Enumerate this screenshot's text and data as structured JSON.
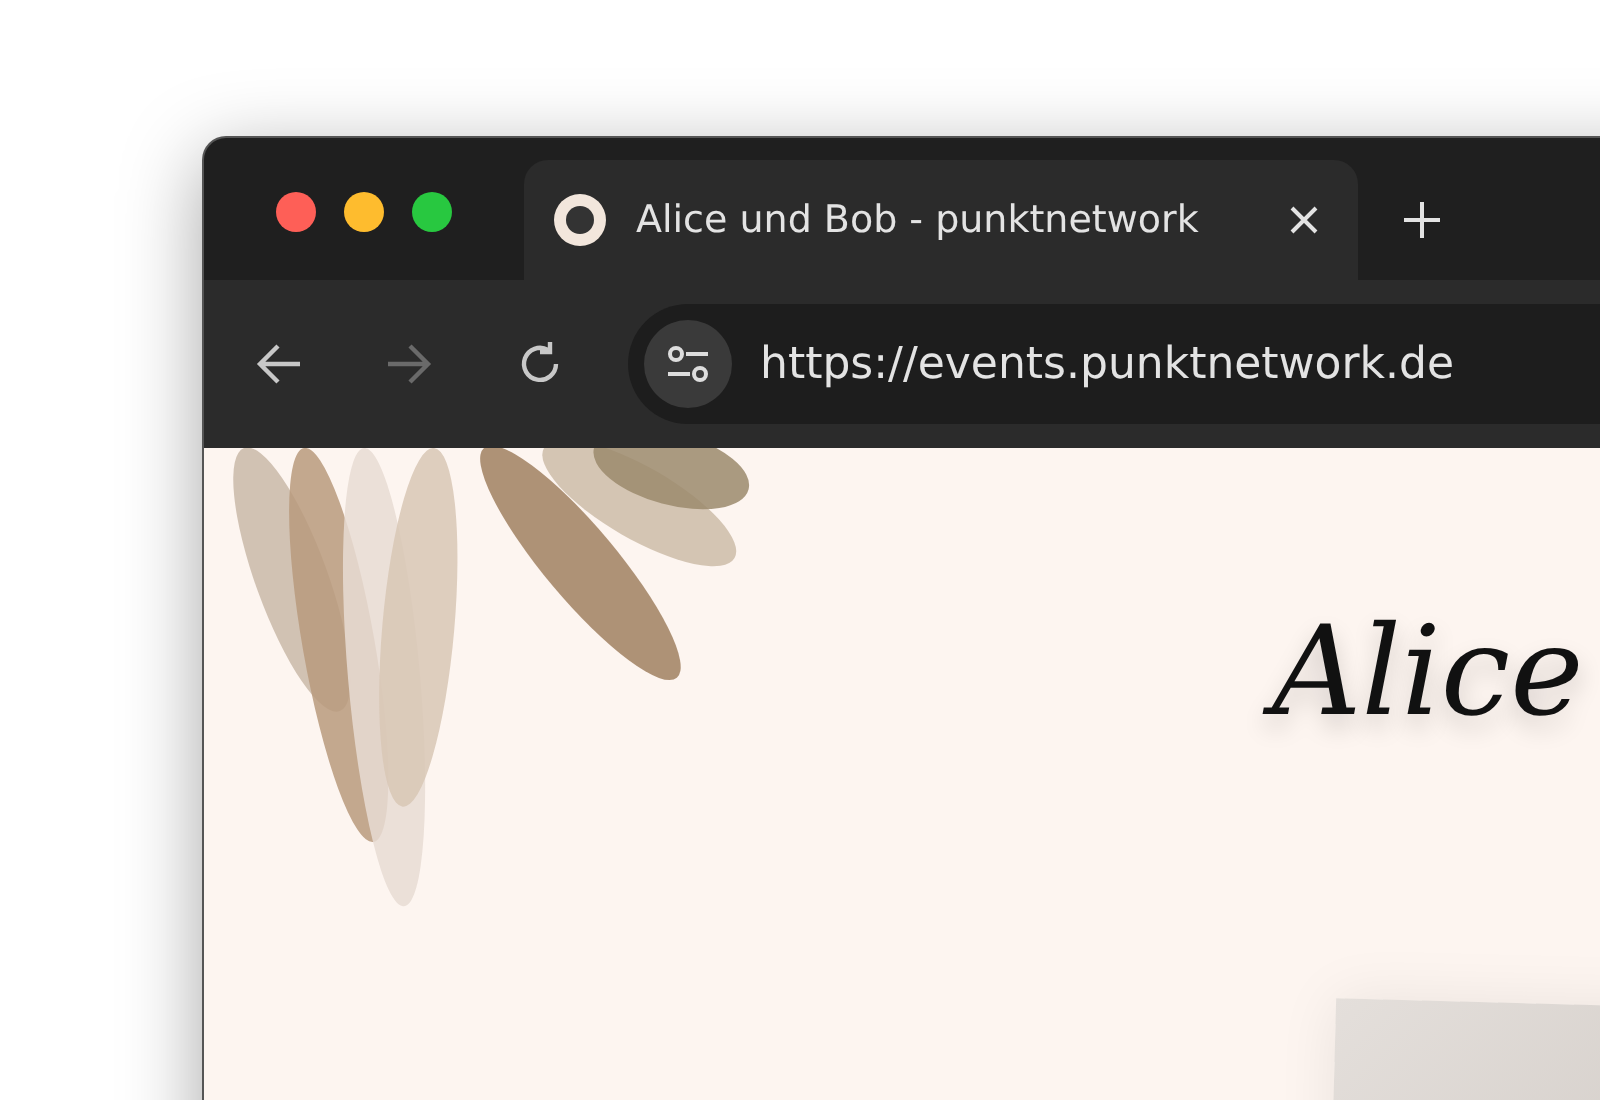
{
  "tabs": [
    {
      "title": "Alice und Bob - punktnetwork",
      "selected": true
    }
  ],
  "toolbar": {
    "back_disabled": false,
    "forward_disabled": true,
    "url": "https://events.punktnetwork.de"
  },
  "page": {
    "heading": "Alice"
  }
}
